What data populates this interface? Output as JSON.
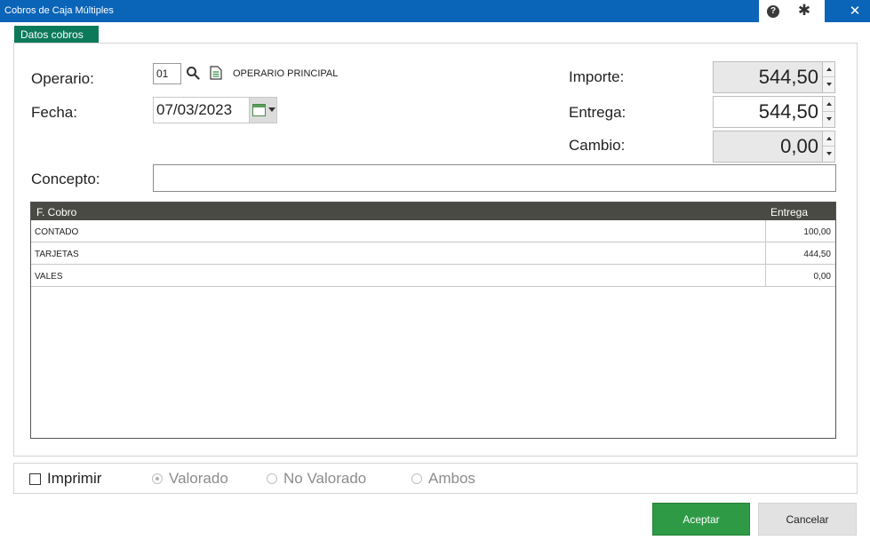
{
  "window": {
    "title": "Cobros de Caja Múltiples",
    "help_glyph": "?",
    "gear_glyph": "✱",
    "close_glyph": "✕"
  },
  "tab": {
    "label": "Datos cobros"
  },
  "form": {
    "operario_label": "Operario:",
    "operario_code": "01",
    "operario_name": "OPERARIO PRINCIPAL",
    "fecha_label": "Fecha:",
    "fecha_value": "07/03/2023",
    "concepto_label": "Concepto:",
    "concepto_value": "",
    "importe_label": "Importe:",
    "importe_value": "544,50",
    "entrega_label": "Entrega:",
    "entrega_value": "544,50",
    "cambio_label": "Cambio:",
    "cambio_value": "0,00"
  },
  "grid": {
    "columns": [
      "F. Cobro",
      "Entrega"
    ],
    "rows": [
      {
        "forma": "CONTADO",
        "entrega": "100,00"
      },
      {
        "forma": "TARJETAS",
        "entrega": "444,50"
      },
      {
        "forma": "VALES",
        "entrega": "0,00"
      }
    ]
  },
  "options": {
    "imprimir_label": "Imprimir",
    "imprimir_checked": false,
    "valorado_label": "Valorado",
    "no_valorado_label": "No Valorado",
    "ambos_label": "Ambos",
    "selected": "Valorado"
  },
  "buttons": {
    "accept": "Aceptar",
    "cancel": "Cancelar"
  },
  "colors": {
    "titlebar": "#0a64b8",
    "tab": "#0c7a5a",
    "grid_header": "#4a4a44",
    "accept_button": "#2e9a46"
  }
}
